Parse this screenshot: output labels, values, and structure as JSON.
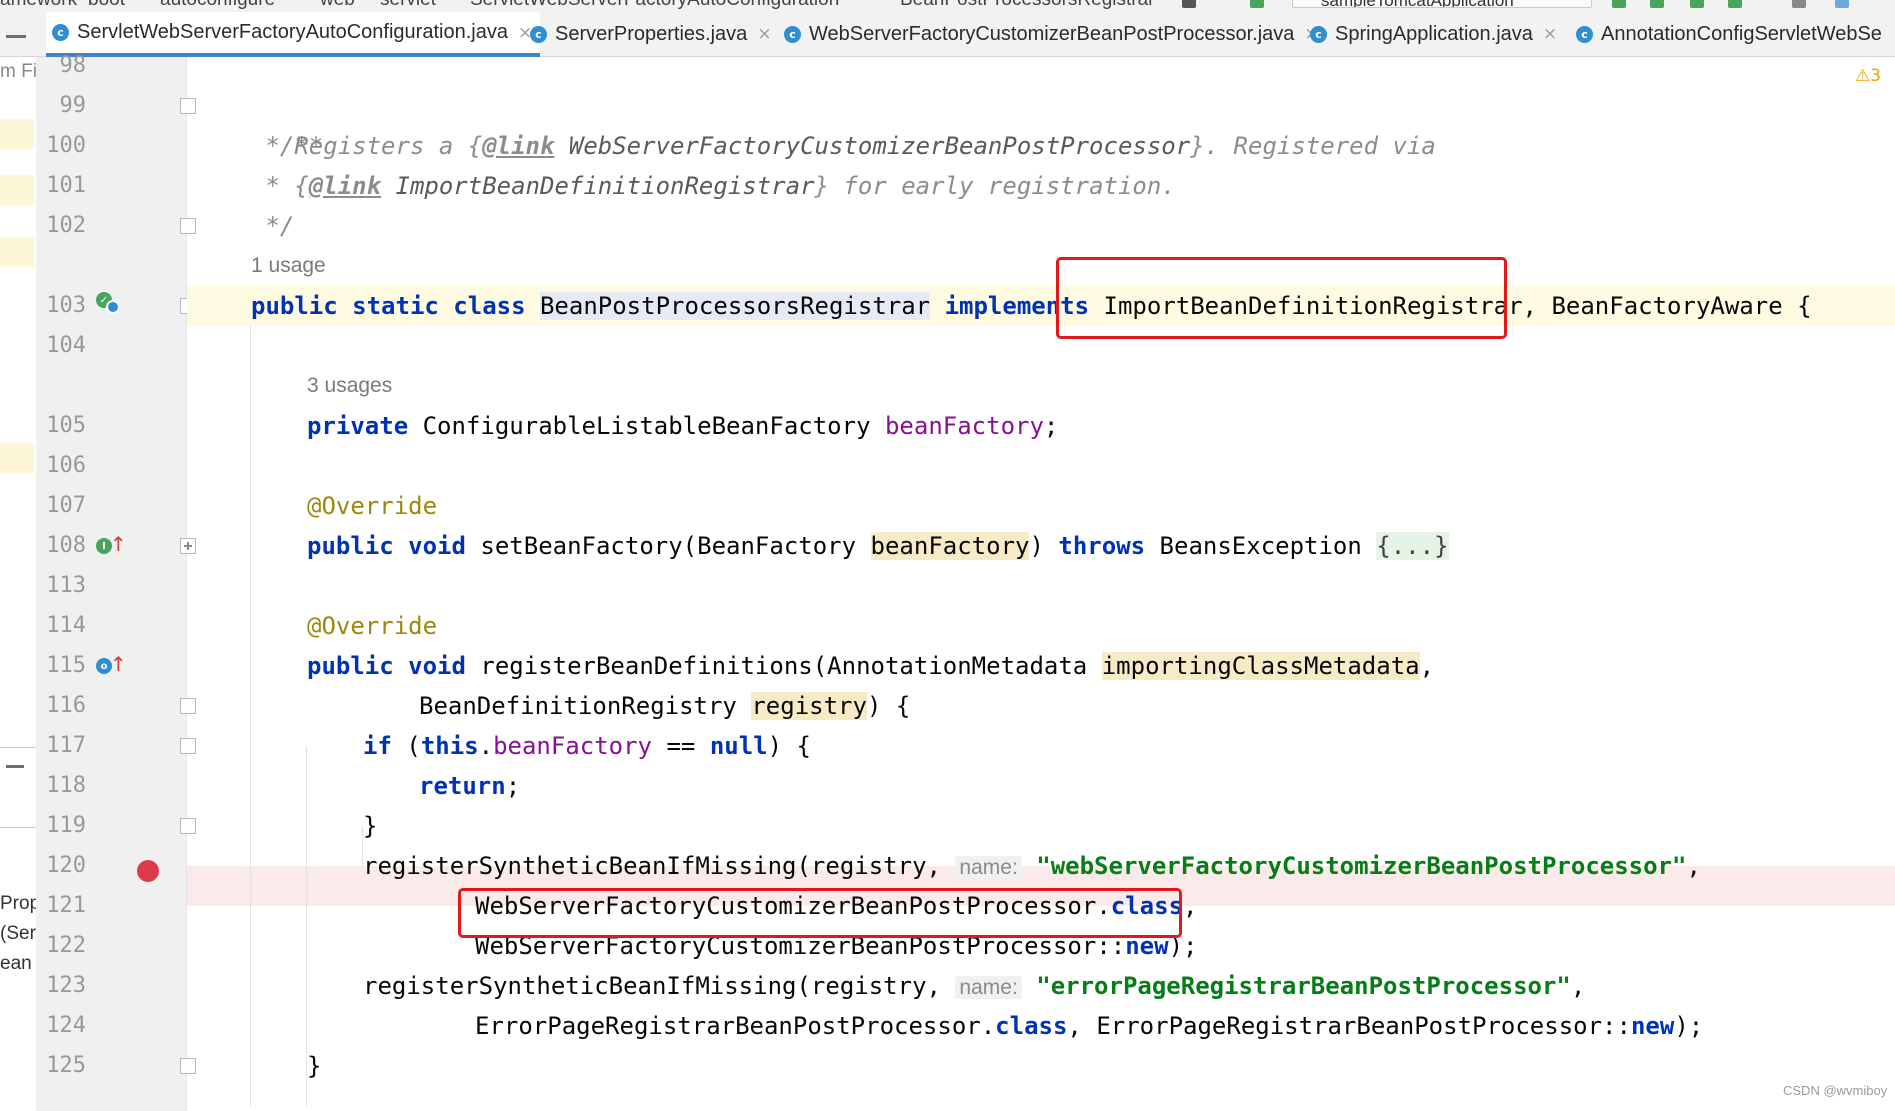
{
  "breadcrumbs": [
    "amework",
    "boot",
    "autoconfigure",
    "web",
    "servlet",
    "ServletWebServerFactoryAutoConfiguration",
    "BeanPostProcessorsRegistrar"
  ],
  "run_config": "sampleTomcatApplication",
  "tabs": [
    {
      "label": "ServletWebServerFactoryAutoConfiguration.java",
      "active": true,
      "closable": true
    },
    {
      "label": "ServerProperties.java",
      "active": false,
      "closable": true
    },
    {
      "label": "WebServerFactoryCustomizerBeanPostProcessor.java",
      "active": false,
      "closable": true
    },
    {
      "label": "SpringApplication.java",
      "active": false,
      "closable": true
    },
    {
      "label": "AnnotationConfigServletWebSe",
      "active": false,
      "closable": false
    }
  ],
  "left_panel_fragments": {
    "top": "m Fi",
    "lines": [
      "Prop",
      "(Serv",
      "ean"
    ]
  },
  "line_numbers": [
    "98",
    "99",
    "100",
    "101",
    "102",
    "103",
    "104",
    "105",
    "106",
    "107",
    "108",
    "113",
    "114",
    "115",
    "116",
    "117",
    "118",
    "119",
    "120",
    "121",
    "122",
    "123",
    "124",
    "125"
  ],
  "code": {
    "l99": "/**",
    "l100_a": " * Registers a {",
    "l100_link": "@link",
    "l100_ref": " WebServerFactoryCustomizerBeanPostProcessor",
    "l100_b": "}. Registered via",
    "l101_a": " * {",
    "l101_link": "@link",
    "l101_ref": " ImportBeanDefinitionRegistrar",
    "l101_b": "} for early registration.",
    "l102": " */",
    "usage_1": "1 usage",
    "l103_kw": "public static class ",
    "l103_cls": "BeanPostProcessorsRegistrar",
    "l103_impl": " implements",
    "l103_rest": " ImportBeanDefinitionRegistrar, BeanFactoryAware {",
    "usage_3": "3 usages",
    "l105_kw": "private ",
    "l105_type": "ConfigurableListableBeanFactory ",
    "l105_field": "beanFactory",
    "l105_end": ";",
    "l107": "@Override",
    "l108_kw": "public void ",
    "l108_a": "setBeanFactory(BeanFactory ",
    "l108_param": "beanFactory",
    "l108_b": ") ",
    "l108_throws": "throws",
    "l108_c": " BeansException ",
    "l108_fold": "{...}",
    "l114": "@Override",
    "l115_kw": "public void ",
    "l115_a": "registerBeanDefinitions(AnnotationMetadata ",
    "l115_param": "importingClassMetadata",
    "l115_b": ",",
    "l116_a": "BeanDefinitionRegistry ",
    "l116_param": "registry",
    "l116_b": ") {",
    "l117_kw": "if",
    "l117_a": " (",
    "l117_this": "this",
    "l117_dot": ".",
    "l117_field": "beanFactory",
    "l117_b": " == ",
    "l117_null": "null",
    "l117_c": ") {",
    "l118_kw": "return",
    "l118_end": ";",
    "l119": "}",
    "l120_a": "registerSyntheticBeanIfMissing(registry, ",
    "l120_hint": "name:",
    "l120_str": "\"webServerFactoryCustomizerBeanPostProcessor\"",
    "l120_end": ",",
    "l121_a": "WebServerFactoryCustomizerBeanPostProcessor.",
    "l121_kw": "class",
    "l121_end": ",",
    "l122_a": "WebServerFactoryCustomizerBeanPostProcessor::",
    "l122_kw": "new",
    "l122_end": ");",
    "l123_a": "registerSyntheticBeanIfMissing(registry, ",
    "l123_hint": "name:",
    "l123_str": "\"errorPageRegistrarBeanPostProcessor\"",
    "l123_end": ",",
    "l124_a": "ErrorPageRegistrarBeanPostProcessor.",
    "l124_kw": "class",
    "l124_b": ", ErrorPageRegistrarBeanPostProcessor::",
    "l124_new": "new",
    "l124_end": ");",
    "l125": "}"
  },
  "inspection_warning": "3",
  "watermark": "CSDN @wvmiboy",
  "colors": {
    "keyword": "#0033b3",
    "string": "#067d17",
    "field": "#871094",
    "annotation": "#9e880d",
    "comment": "#8c8c8c",
    "annotation_box": "#e3181c",
    "breakpoint": "#db3b4b",
    "active_tab_underline": "#4083c9"
  }
}
